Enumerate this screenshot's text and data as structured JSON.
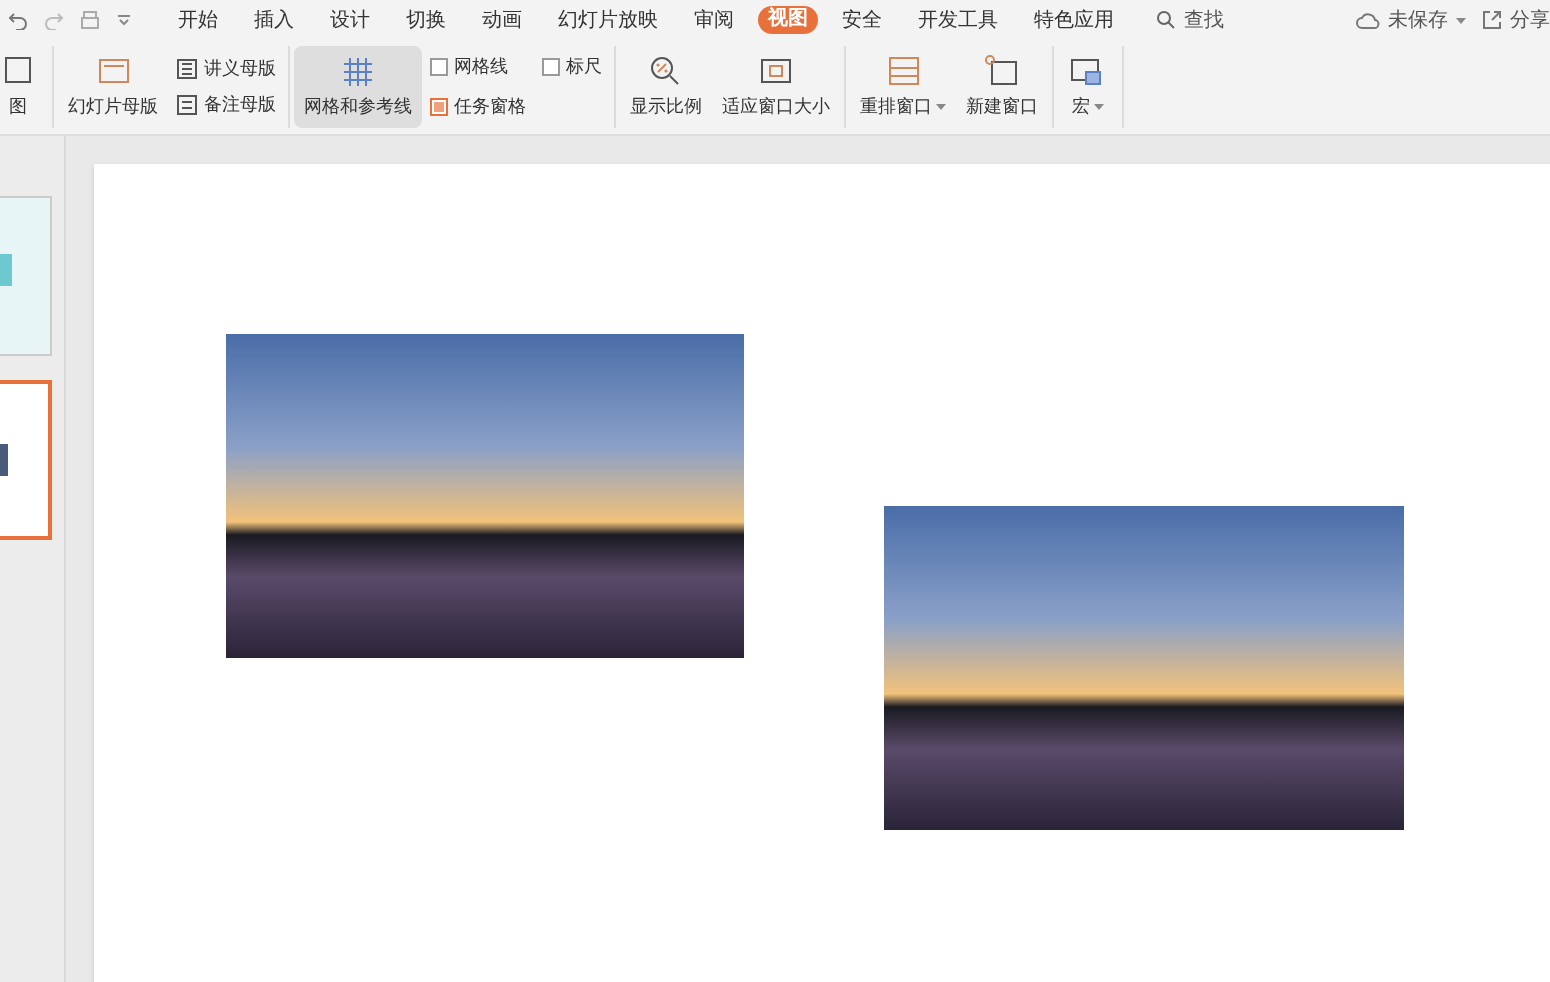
{
  "menu_tabs": [
    {
      "label": "开始",
      "selected": false
    },
    {
      "label": "插入",
      "selected": false
    },
    {
      "label": "设计",
      "selected": false
    },
    {
      "label": "切换",
      "selected": false
    },
    {
      "label": "动画",
      "selected": false
    },
    {
      "label": "幻灯片放映",
      "selected": false
    },
    {
      "label": "审阅",
      "selected": false
    },
    {
      "label": "视图",
      "selected": true
    },
    {
      "label": "安全",
      "selected": false
    },
    {
      "label": "开发工具",
      "selected": false
    },
    {
      "label": "特色应用",
      "selected": false
    }
  ],
  "search": {
    "label": "查找"
  },
  "save_status": "未保存",
  "share": "分享",
  "ribbon": [
    {
      "kind": "large",
      "label": "图",
      "selected": false
    },
    {
      "kind": "large",
      "label": "幻灯片母版",
      "selected": false
    },
    {
      "kind": "stack",
      "items": [
        {
          "label": "讲义母版"
        },
        {
          "label": "备注母版"
        }
      ]
    },
    {
      "kind": "large",
      "label": "网格和参考线",
      "selected": true
    },
    {
      "kind": "checks",
      "items": [
        {
          "label": "网格线",
          "checked": false
        },
        {
          "label": "任务窗格",
          "checked": true
        }
      ]
    },
    {
      "kind": "checks",
      "items": [
        {
          "label": "标尺",
          "checked": false
        }
      ]
    },
    {
      "kind": "large",
      "label": "显示比例",
      "selected": false
    },
    {
      "kind": "large",
      "label": "适应窗口大小",
      "selected": false
    },
    {
      "kind": "large",
      "label": "重排窗口",
      "selected": false,
      "dropdown": true
    },
    {
      "kind": "large",
      "label": "新建窗口",
      "selected": false
    },
    {
      "kind": "large",
      "label": "宏",
      "selected": false,
      "dropdown": true
    }
  ],
  "thumbnails": [
    {
      "selected": false
    },
    {
      "selected": true
    }
  ]
}
